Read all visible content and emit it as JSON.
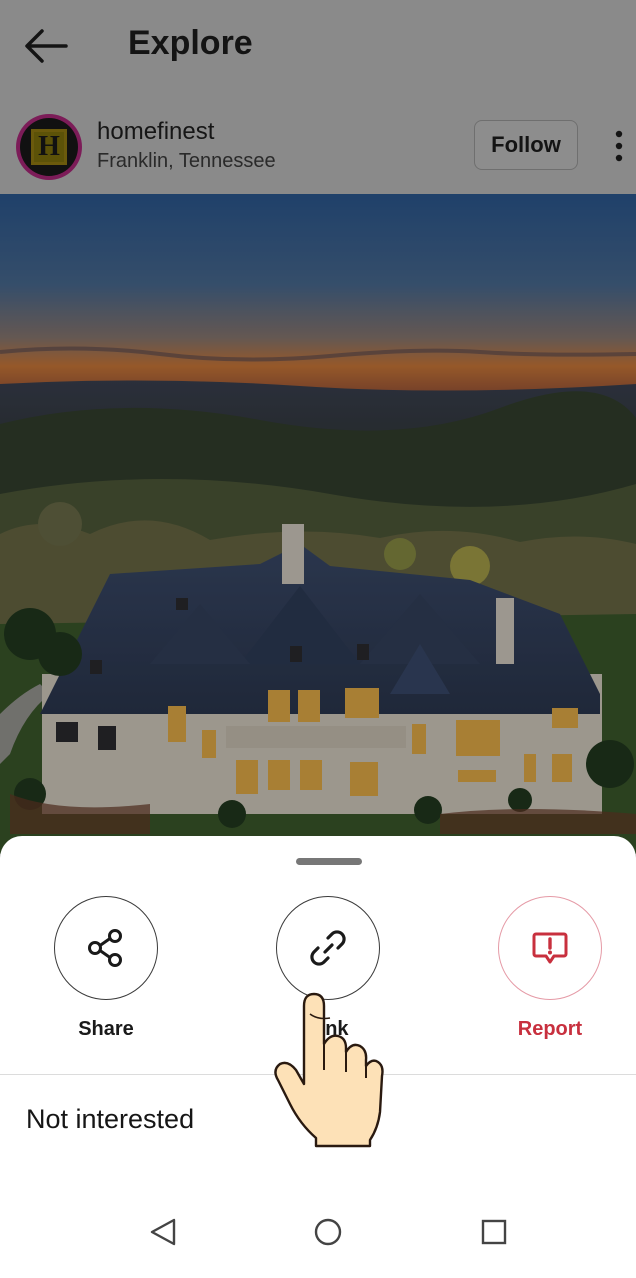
{
  "header": {
    "title": "Explore",
    "back_icon": "arrow-left-icon"
  },
  "post": {
    "username": "homefinest",
    "location": "Franklin, Tennessee",
    "follow_label": "Follow",
    "more_icon": "more-vertical-icon",
    "avatar_letter": "H"
  },
  "sheet": {
    "actions": [
      {
        "label": "Share",
        "icon": "share-icon"
      },
      {
        "label": "Link",
        "icon": "link-icon"
      },
      {
        "label": "Report",
        "icon": "report-icon",
        "color": "#c8303e"
      }
    ],
    "not_interested_label": "Not interested"
  },
  "navbar": {
    "back_icon": "triangle-back-icon",
    "home_icon": "circle-home-icon",
    "recents_icon": "square-recents-icon"
  },
  "colors": {
    "report": "#c8303e",
    "dim_overlay": "#8a8a8a"
  }
}
